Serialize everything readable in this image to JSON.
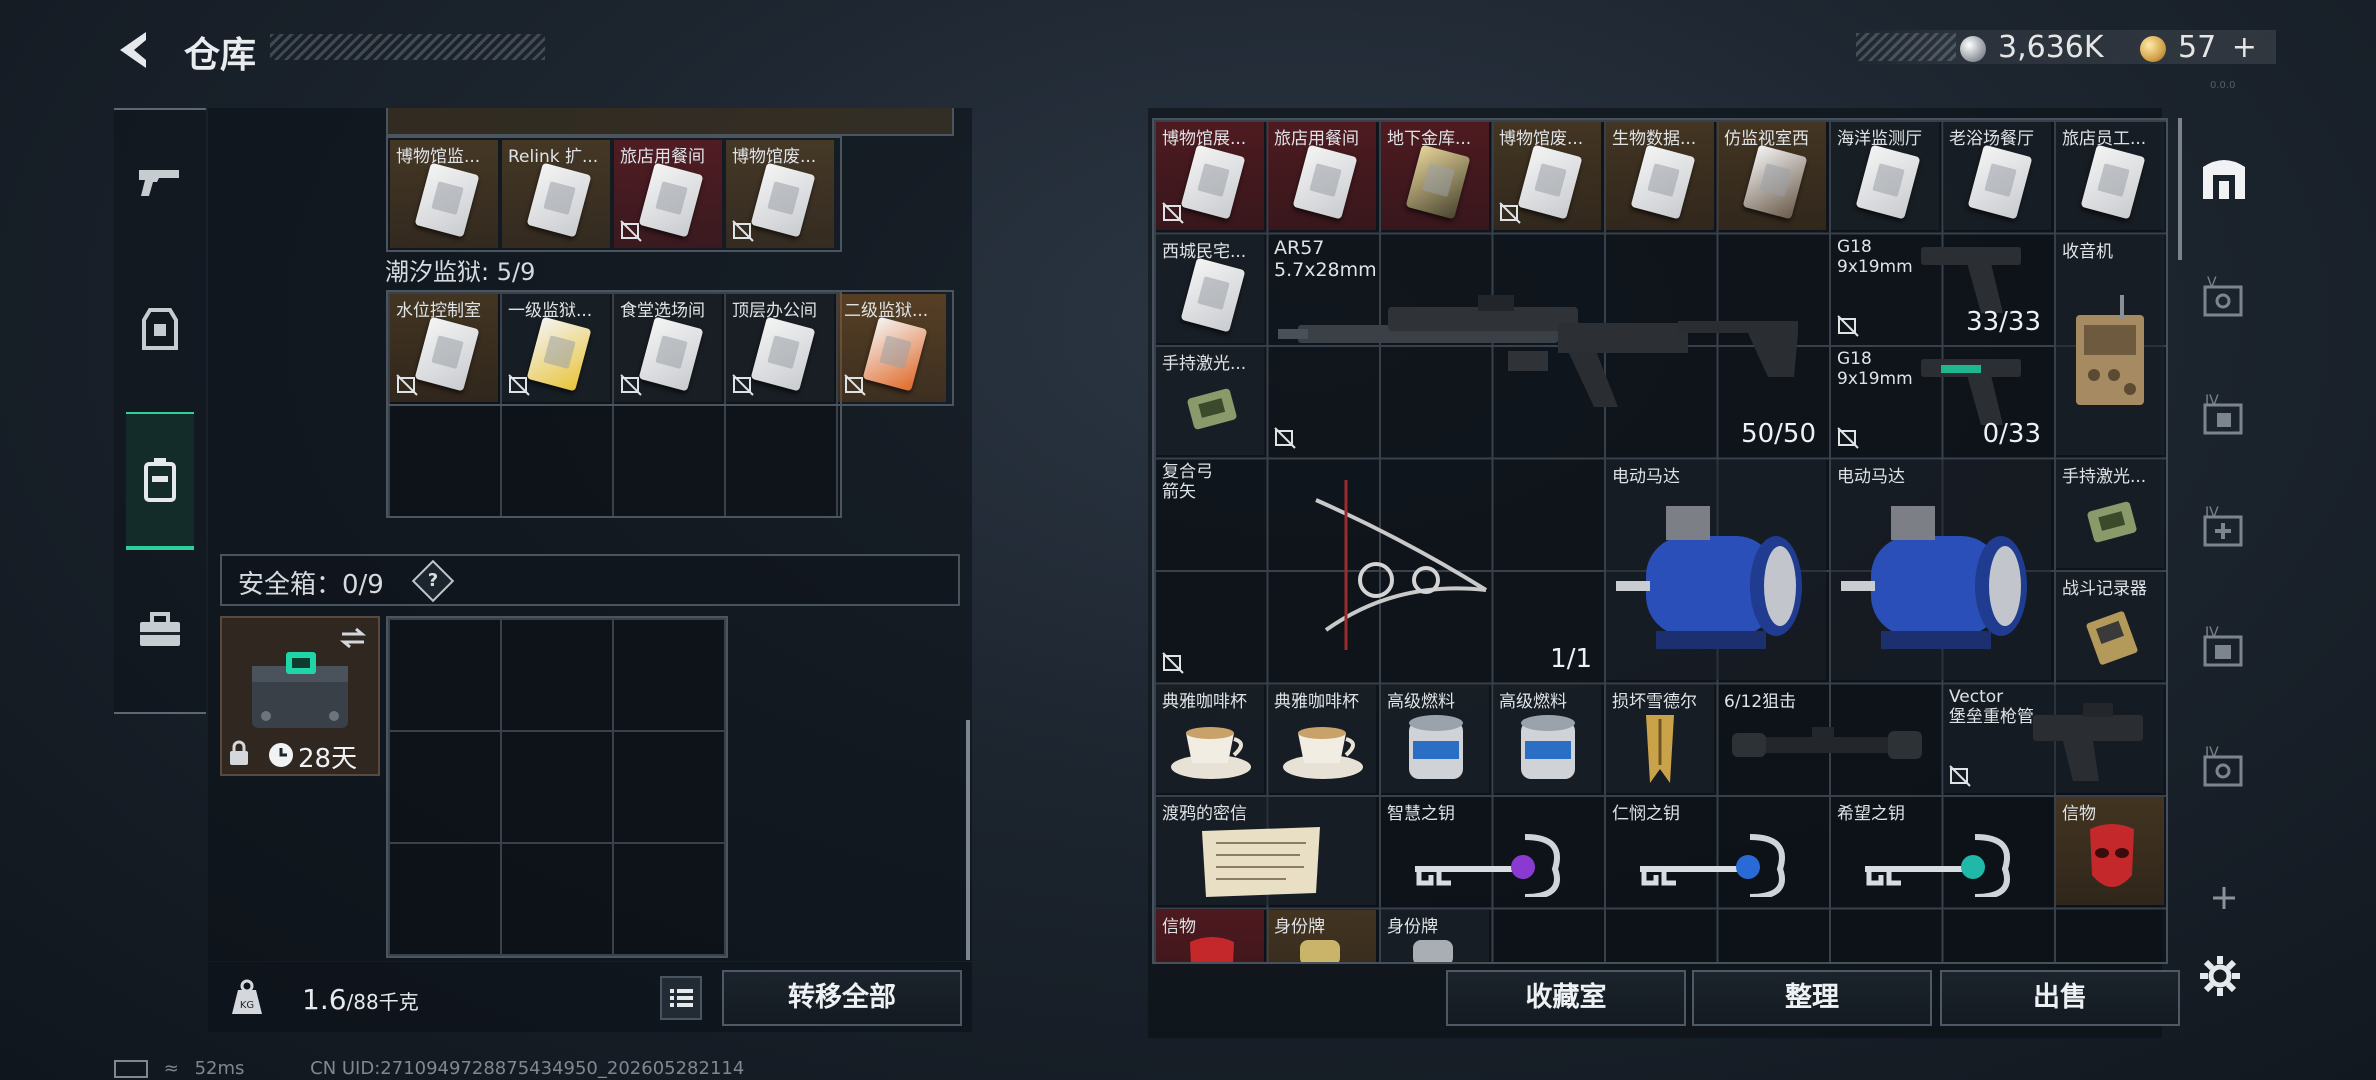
{
  "header": {
    "title": "仓库",
    "silver": "3,636K",
    "gold": "57",
    "gold_plus": "+",
    "version": "0.0.0"
  },
  "left_tabs": [
    "pistol-icon",
    "armor-vest-icon",
    "backpack-icon",
    "toolbox-icon"
  ],
  "left_panel": {
    "row_top": [
      {
        "name": "博物馆监..."
      },
      {
        "name": "Relink 扩..."
      },
      {
        "name": "旅店用餐间"
      },
      {
        "name": "博物馆废..."
      }
    ],
    "prison_label": "潮汐监狱: 5/9",
    "prison_row": [
      {
        "name": "水位控制室"
      },
      {
        "name": "一级监狱..."
      },
      {
        "name": "食堂选场间"
      },
      {
        "name": "顶层办公间"
      },
      {
        "name": "二级监狱..."
      }
    ],
    "safe_label": "安全箱：0/9",
    "safe_help": "?",
    "safe_case_days": "28天",
    "weight": "1.6",
    "weight_max": "/88千克",
    "transfer_all": "转移全部"
  },
  "right_panel": {
    "row1": [
      "博物馆展...",
      "旅店用餐间",
      "地下金库...",
      "博物馆废...",
      "生物数据...",
      "仿监视室西",
      "海洋监测厅",
      "老浴场餐厅",
      "旅店员工..."
    ],
    "xicheng": "西城民宅...",
    "ar57": {
      "name": "AR57",
      "cal": "5.7x28mm",
      "count": "50/50"
    },
    "g18a": {
      "name": "G18",
      "cal": "9x19mm",
      "count": "33/33"
    },
    "g18b": {
      "name": "G18",
      "cal": "9x19mm",
      "count": "0/33"
    },
    "radio": "收音机",
    "laser1": "手持激光...",
    "bow": {
      "name": "复合弓",
      "sub": "箭矢",
      "count": "1/1"
    },
    "motor1": "电动马达",
    "motor2": "电动马达",
    "laser2": "手持激光...",
    "recorder": "战斗记录器",
    "cup1": "典雅咖啡杯",
    "cup2": "典雅咖啡杯",
    "fuel1": "高级燃料",
    "fuel2": "高级燃料",
    "damaged": "损坏雪德尔",
    "scope": "6/12狙击",
    "vector": {
      "name": "Vector",
      "sub": "堡垒重枪管"
    },
    "letter": "渡鸦的密信",
    "key1": "智慧之钥",
    "key2": "仁悯之钥",
    "key3": "希望之钥",
    "relic1": "信物",
    "relic2": "信物",
    "tag1": "身份牌",
    "tag2": "身份牌",
    "btn_collection": "收藏室",
    "btn_sort": "整理",
    "btn_sell": "出售"
  },
  "right_tabs": [
    "home-vault-icon",
    "storage-v-icon",
    "storage-iv-icon",
    "storage-iv-medical-icon",
    "storage-iv-armor-icon",
    "storage-iv-misc-icon",
    "add-icon",
    "settings-gear-icon"
  ],
  "status": {
    "ping": "52ms",
    "uid": "CN UID:2710949728875434950_202605282114"
  },
  "colors": {
    "accent": "#2ecf9a",
    "rare_gold": "#6e5028",
    "rare_red": "#781e23"
  }
}
